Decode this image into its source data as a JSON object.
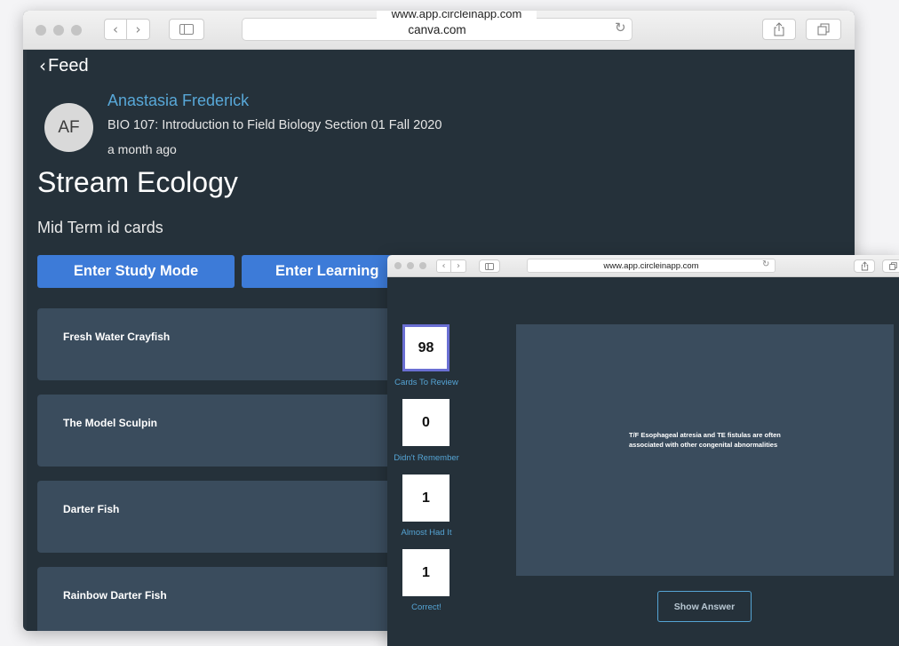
{
  "main_window": {
    "url_banner": "www.app.circleinapp.com",
    "address": "canva.com",
    "back_label": "Feed",
    "author_initials": "AF",
    "author_name": "Anastasia Frederick",
    "course": "BIO 107: Introduction to Field Biology Section 01 Fall 2020",
    "timestamp": "a month ago",
    "title": "Stream Ecology",
    "description": "Mid Term id cards",
    "buttons": {
      "study_mode": "Enter Study Mode",
      "learning": "Enter Learning"
    },
    "cards": [
      "Fresh Water Crayfish",
      "The Model Sculpin",
      "Darter Fish",
      "Rainbow Darter Fish"
    ]
  },
  "study_window": {
    "address": "www.app.circleinapp.com",
    "counters": [
      {
        "value": "98",
        "label": "Cards To Review",
        "active": true
      },
      {
        "value": "0",
        "label": "Didn't Remember"
      },
      {
        "value": "1",
        "label": "Almost Had It"
      },
      {
        "value": "1",
        "label": "Correct!"
      }
    ],
    "question": "T/F Esophageal atresia and TE fistulas are often associated with other congenital abnormalities",
    "show_answer": "Show Answer"
  },
  "icons": {
    "back": "chevron-left-icon",
    "forward": "chevron-right-icon",
    "sidebar": "sidebar-icon",
    "reload": "reload-icon",
    "share": "share-icon",
    "tabs": "tabs-icon"
  },
  "colors": {
    "background_dark": "#25313a",
    "card": "#3a4c5d",
    "button_blue": "#3d7bd8",
    "link_blue": "#58a8d8",
    "active_border": "#6a6fd3"
  }
}
